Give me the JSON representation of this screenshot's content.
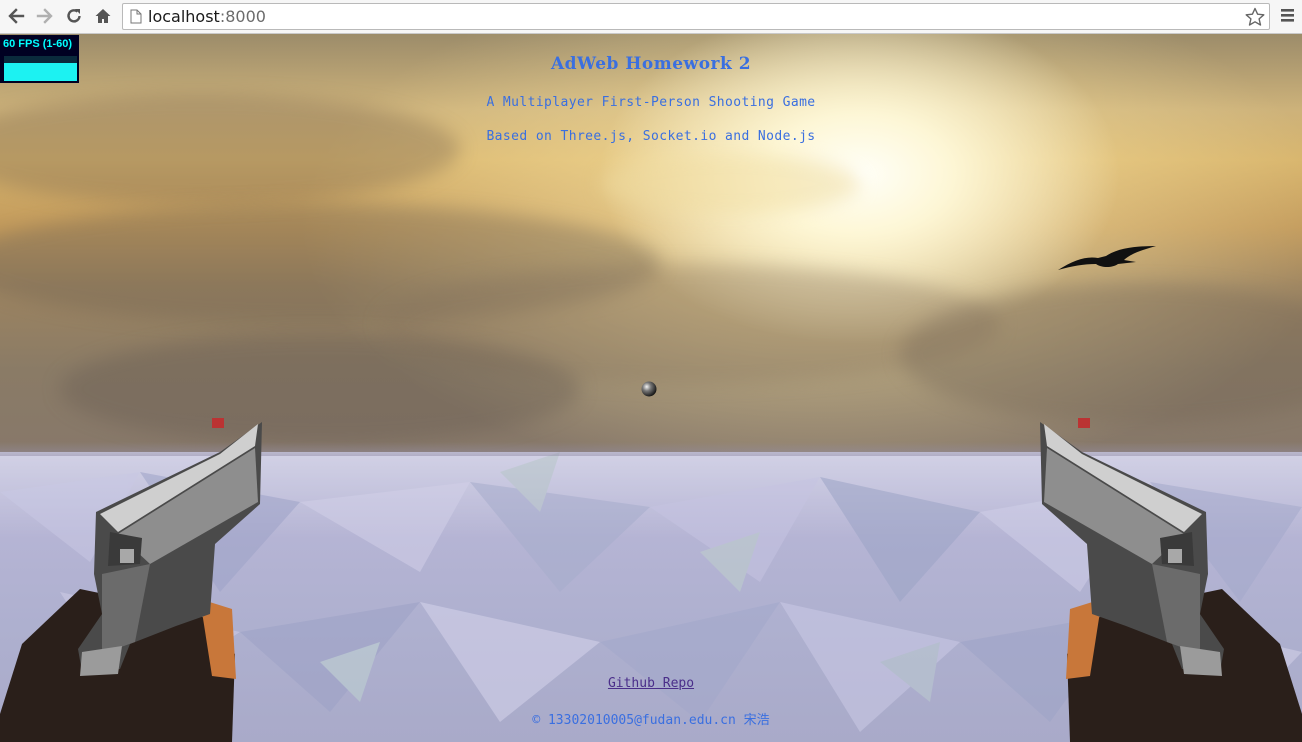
{
  "browser": {
    "url_host": "localhost",
    "url_port": ":8000",
    "back_icon": "arrow-left-icon",
    "forward_icon": "arrow-right-icon",
    "reload_icon": "reload-icon",
    "home_icon": "home-icon",
    "bookmark_icon": "star-outline-icon",
    "menu_icon": "hamburger-menu-icon"
  },
  "stats": {
    "fps_label": "60 FPS (1-60)"
  },
  "page": {
    "title": "AdWeb Homework 2",
    "subtitle": "A Multiplayer First-Person Shooting Game",
    "tech_line": "Based on Three.js, Socket.io and Node.js",
    "repo_link": "Github Repo",
    "credit": "© 13302010005@fudan.edu.cn 宋浩"
  },
  "colors": {
    "text_blue": "#3a6fe0",
    "link_purple": "#4a2e8a",
    "fps_cyan": "#00ffff"
  }
}
